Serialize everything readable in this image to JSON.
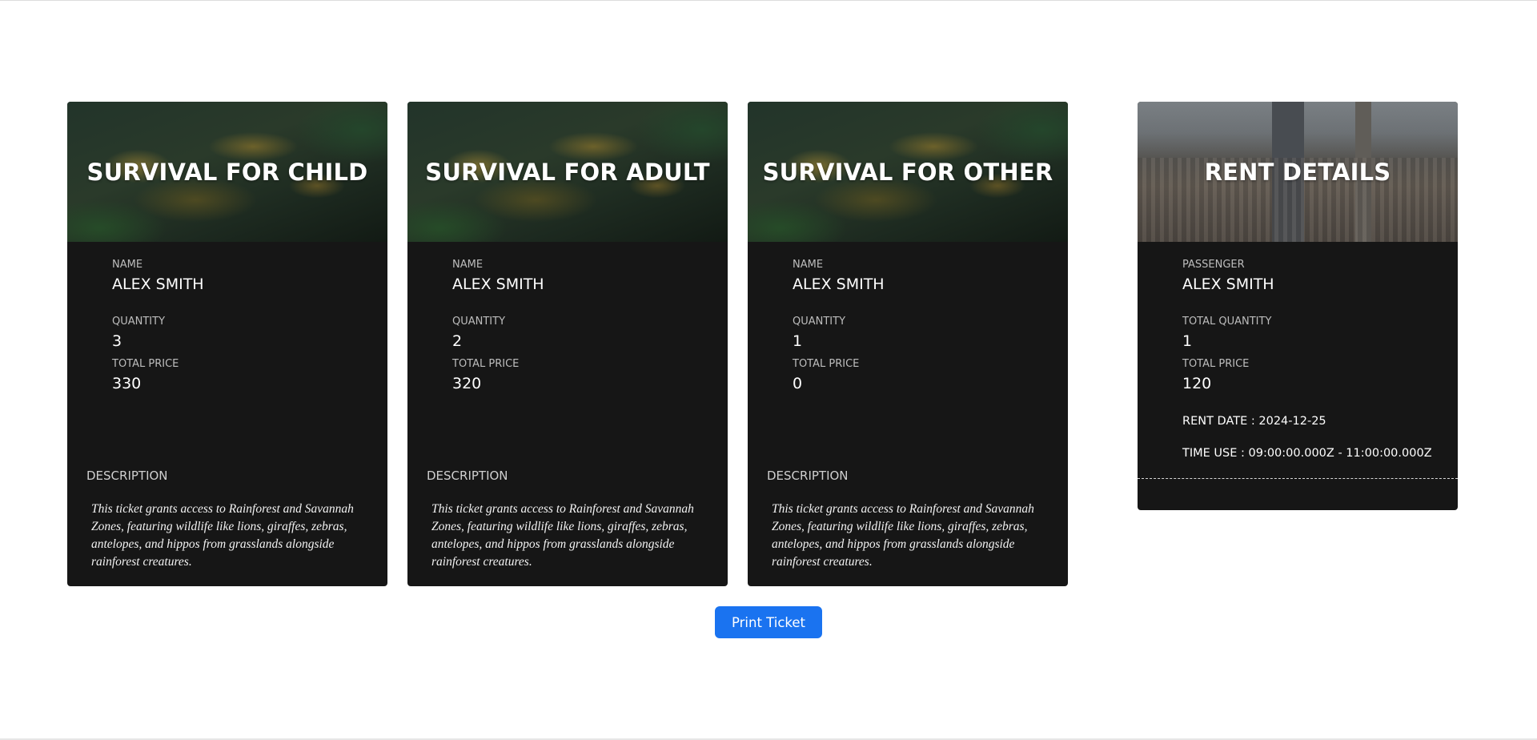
{
  "tickets": [
    {
      "title": "SURVIVAL FOR CHILD",
      "name_label": "NAME",
      "name": "ALEX SMITH",
      "quantity_label": "QUANTITY",
      "quantity": "3",
      "price_label": "TOTAL PRICE",
      "price": "330",
      "description_label": "DESCRIPTION",
      "description": "This ticket grants access to Rainforest and Savannah Zones, featuring wildlife like lions, giraffes, zebras, antelopes, and hippos from grasslands alongside rainforest creatures."
    },
    {
      "title": "SURVIVAL FOR ADULT",
      "name_label": "NAME",
      "name": "ALEX SMITH",
      "quantity_label": "QUANTITY",
      "quantity": "2",
      "price_label": "TOTAL PRICE",
      "price": "320",
      "description_label": "DESCRIPTION",
      "description": "This ticket grants access to Rainforest and Savannah Zones, featuring wildlife like lions, giraffes, zebras, antelopes, and hippos from grasslands alongside rainforest creatures."
    },
    {
      "title": "SURVIVAL FOR OTHER",
      "name_label": "NAME",
      "name": "ALEX SMITH",
      "quantity_label": "QUANTITY",
      "quantity": "1",
      "price_label": "TOTAL PRICE",
      "price": "0",
      "description_label": "DESCRIPTION",
      "description": "This ticket grants access to Rainforest and Savannah Zones, featuring wildlife like lions, giraffes, zebras, antelopes, and hippos from grasslands alongside rainforest creatures."
    }
  ],
  "rent": {
    "title": "RENT DETAILS",
    "passenger_label": "PASSENGER",
    "passenger": "ALEX SMITH",
    "quantity_label": "TOTAL QUANTITY",
    "quantity": "1",
    "price_label": "TOTAL PRICE",
    "price": "120",
    "rent_date": "RENT DATE : 2024-12-25",
    "time_use": "TIME USE : 09:00:00.000Z - 11:00:00.000Z"
  },
  "actions": {
    "print_label": "Print Ticket"
  },
  "colors": {
    "card_bg": "#161616",
    "button_bg": "#1a73f0",
    "page_bg": "#ffffff"
  }
}
